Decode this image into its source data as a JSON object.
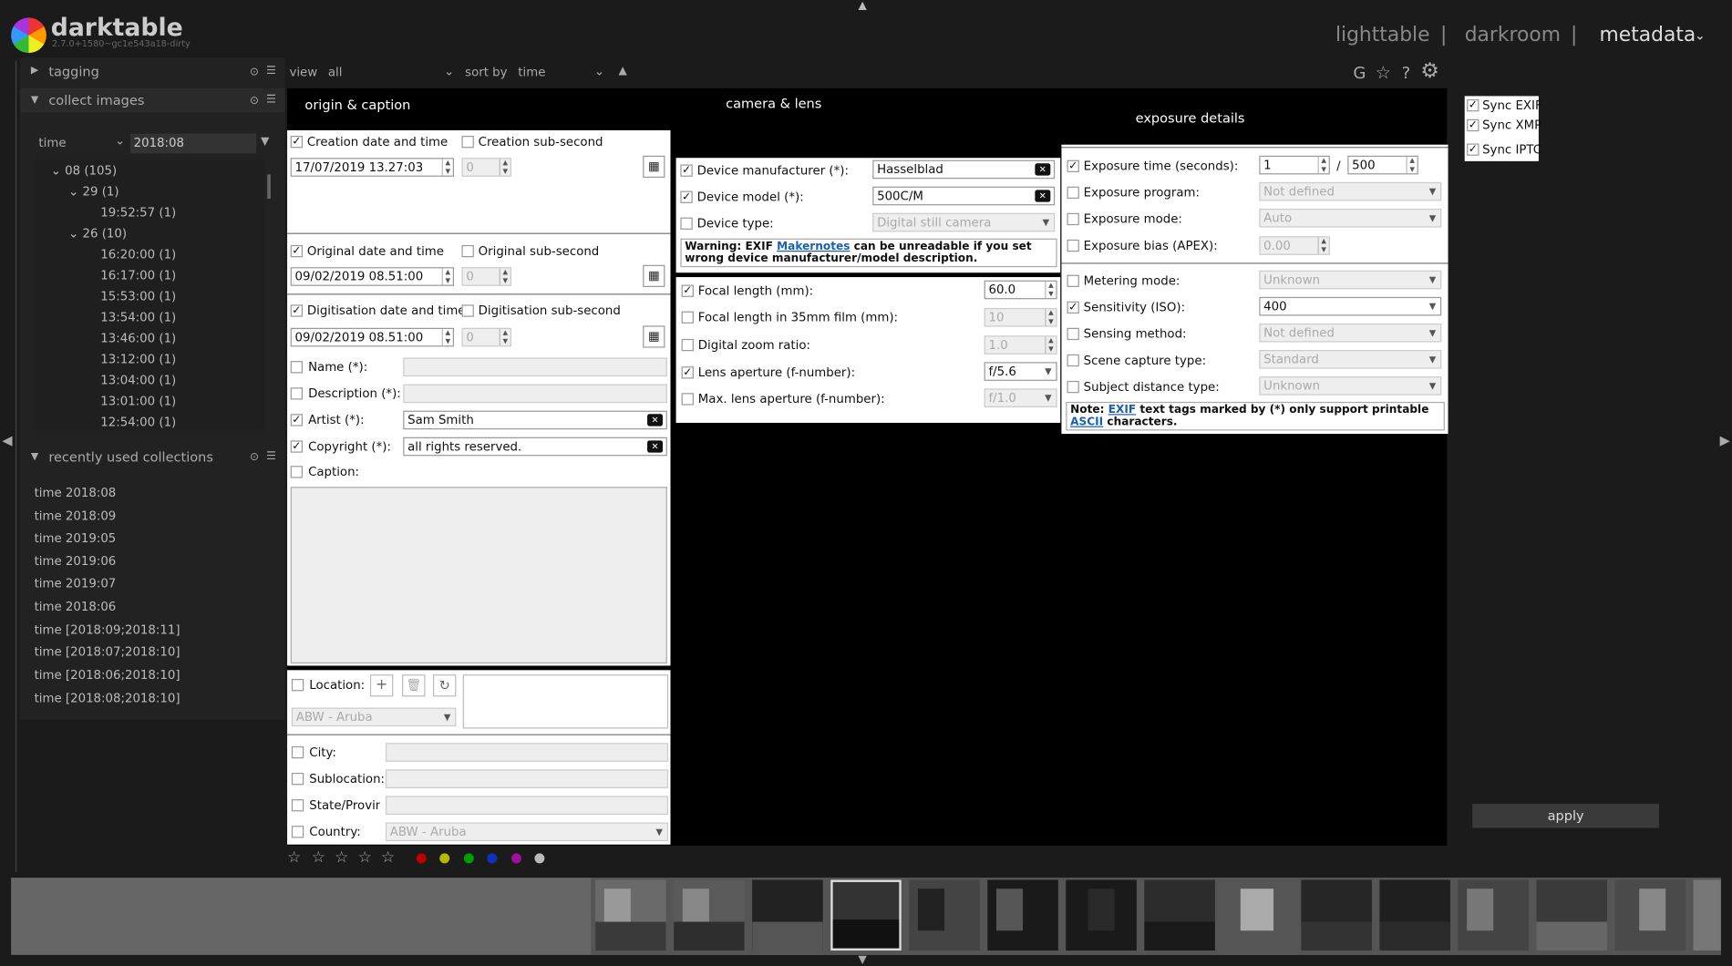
{
  "app": {
    "name": "darktable",
    "version": "2.7.0+1580~gc1e543a18-dirty"
  },
  "views": {
    "lighttable": "lighttable",
    "darkroom": "darkroom",
    "metadata": "metadata",
    "sep": "|"
  },
  "left": {
    "tagging": "tagging",
    "collect": "collect images",
    "rule": {
      "field": "time",
      "value": "2018:08"
    },
    "tree": [
      "08 (105)",
      "29 (1)",
      "19:52:57 (1)",
      "26 (10)",
      "16:20:00 (1)",
      "16:17:00 (1)",
      "15:53:00 (1)",
      "13:54:00 (1)",
      "13:46:00 (1)",
      "13:12:00 (1)",
      "13:04:00 (1)",
      "13:01:00 (1)",
      "12:54:00 (1)"
    ],
    "recent": "recently used collections",
    "recent_items": [
      "time 2018:08",
      "time 2018:09",
      "time 2019:05",
      "time 2019:06",
      "time 2019:07",
      "time 2018:06",
      "time [2018:09;2018:11]",
      "time [2018:07;2018:10]",
      "time [2018:06;2018:10]",
      "time [2018:08;2018:10]"
    ]
  },
  "top": {
    "view_label": "view",
    "view_value": "all",
    "sort_label": "sort by",
    "sort_value": "time",
    "sort_arrow": "▲",
    "icons": {
      "g": "G",
      "star": "☆",
      "help": "?",
      "gear": "⚙"
    }
  },
  "origin": {
    "title": "origin & caption",
    "creation": "Creation date and time",
    "creation_val": "17/07/2019 13.27:03",
    "creation_sub": "Creation sub-second",
    "sub_val": "0",
    "original": "Original date and time",
    "original_val": "09/02/2019 08.51:00",
    "original_sub": "Original sub-second",
    "digit": "Digitisation date and time",
    "digit_val": "09/02/2019 08.51:00",
    "digit_sub": "Digitisation sub-second",
    "name": "Name (*):",
    "desc": "Description (*):",
    "artist": "Artist (*):",
    "artist_val": "Sam Smith",
    "copyright": "Copyright (*):",
    "copyright_val": "all rights reserved.",
    "caption": "Caption:",
    "location": "Location:",
    "country_sel": "ABW - Aruba",
    "city": "City:",
    "subloc": "Sublocation:",
    "state": "State/Provinc",
    "country": "Country:",
    "country_val": "ABW - Aruba"
  },
  "camera": {
    "title": "camera & lens",
    "manuf": "Device manufacturer (*):",
    "manuf_val": "Hasselblad",
    "model": "Device model (*):",
    "model_val": "500C/M",
    "type": "Device type:",
    "type_val": "Digital still camera",
    "warn_a": "Warning: EXIF ",
    "warn_link": "Makernotes",
    "warn_b": " can be unreadable if you set wrong device manufacturer/model description.",
    "focal": "Focal length (mm):",
    "focal_val": "60.0",
    "focal35": "Focal length in 35mm film (mm):",
    "focal35_val": "10",
    "zoom": "Digital zoom ratio:",
    "zoom_val": "1.0",
    "aperture": "Lens aperture (f-number):",
    "aperture_val": "f/5.6",
    "maxap": "Max. lens aperture (f-number):",
    "maxap_val": "f/1.0"
  },
  "exposure": {
    "title": "exposure details",
    "time": "Exposure time (seconds):",
    "time_num": "1",
    "slash": "/",
    "time_den": "500",
    "program": "Exposure program:",
    "program_val": "Not defined",
    "mode": "Exposure mode:",
    "mode_val": "Auto",
    "bias": "Exposure bias (APEX):",
    "bias_val": "0.00",
    "meter": "Metering mode:",
    "meter_val": "Unknown",
    "iso": "Sensitivity (ISO):",
    "iso_val": "400",
    "sensing": "Sensing method:",
    "sensing_val": "Not defined",
    "scene": "Scene capture type:",
    "scene_val": "Standard",
    "dist": "Subject distance type:",
    "dist_val": "Unknown",
    "note_a": "Note: ",
    "note_exif": "EXIF",
    "note_b": " text tags marked by (*) only support printable ",
    "note_ascii": "ASCII",
    "note_c": " characters."
  },
  "sync": {
    "exif": "Sync EXIF",
    "xmp": "Sync XMP",
    "iptc": "Sync IPTC",
    "apply": "apply"
  },
  "colors": {
    "red": "#c00000",
    "yellow": "#b8b800",
    "green": "#00a000",
    "blue": "#1030c0",
    "purple": "#a010a0",
    "gray": "#bbbbbb",
    "link": "#1a5fb4"
  }
}
